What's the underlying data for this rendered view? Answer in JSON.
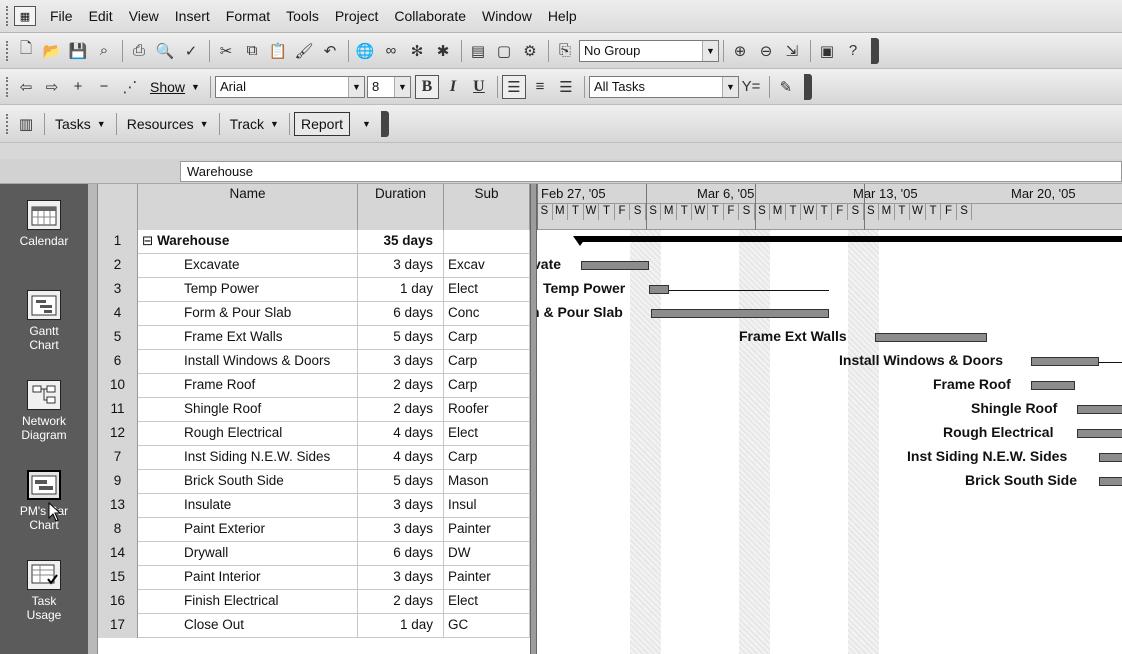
{
  "menu": {
    "items": [
      "File",
      "Edit",
      "View",
      "Insert",
      "Format",
      "Tools",
      "Project",
      "Collaborate",
      "Window",
      "Help"
    ]
  },
  "toolbar_standard": {
    "group_value": "No Group"
  },
  "toolbar_formatting": {
    "show_label": "Show",
    "font_value": "Arial",
    "size_value": "8",
    "bold": "B",
    "italic": "I",
    "underline": "U",
    "filter_value": "All Tasks"
  },
  "project_guide": {
    "tasks": "Tasks",
    "resources": "Resources",
    "track": "Track",
    "report": "Report"
  },
  "entry_bar": {
    "value": "Warehouse"
  },
  "view_bar": {
    "items": [
      {
        "label1": "Calendar",
        "label2": ""
      },
      {
        "label1": "Gantt",
        "label2": "Chart"
      },
      {
        "label1": "Network",
        "label2": "Diagram"
      },
      {
        "label1": "PM's Bar",
        "label2": "Chart"
      },
      {
        "label1": "Task",
        "label2": "Usage"
      }
    ]
  },
  "table": {
    "headers": {
      "name": "Name",
      "duration": "Duration",
      "sub": "Sub"
    },
    "rows": [
      {
        "id": "1",
        "name": "Warehouse",
        "duration": "35 days",
        "sub": "",
        "summary": true
      },
      {
        "id": "2",
        "name": "Excavate",
        "duration": "3 days",
        "sub": "Excav"
      },
      {
        "id": "3",
        "name": "Temp Power",
        "duration": "1 day",
        "sub": "Elect"
      },
      {
        "id": "4",
        "name": "Form & Pour Slab",
        "duration": "6 days",
        "sub": "Conc"
      },
      {
        "id": "5",
        "name": "Frame Ext Walls",
        "duration": "5 days",
        "sub": "Carp"
      },
      {
        "id": "6",
        "name": "Install Windows & Doors",
        "duration": "3 days",
        "sub": "Carp"
      },
      {
        "id": "10",
        "name": "Frame Roof",
        "duration": "2 days",
        "sub": "Carp"
      },
      {
        "id": "11",
        "name": "Shingle Roof",
        "duration": "2 days",
        "sub": "Roofer"
      },
      {
        "id": "12",
        "name": "Rough Electrical",
        "duration": "4 days",
        "sub": "Elect"
      },
      {
        "id": "7",
        "name": "Inst Siding N.E.W. Sides",
        "duration": "4 days",
        "sub": "Carp"
      },
      {
        "id": "9",
        "name": "Brick South Side",
        "duration": "5 days",
        "sub": "Mason"
      },
      {
        "id": "13",
        "name": "Insulate",
        "duration": "3 days",
        "sub": "Insul"
      },
      {
        "id": "8",
        "name": "Paint Exterior",
        "duration": "3 days",
        "sub": "Painter"
      },
      {
        "id": "14",
        "name": "Drywall",
        "duration": "6 days",
        "sub": "DW"
      },
      {
        "id": "15",
        "name": "Paint Interior",
        "duration": "3 days",
        "sub": "Painter"
      },
      {
        "id": "16",
        "name": "Finish Electrical",
        "duration": "2 days",
        "sub": "Elect"
      },
      {
        "id": "17",
        "name": "Close Out",
        "duration": "1 day",
        "sub": "GC"
      }
    ]
  },
  "gantt": {
    "weeks": [
      "Feb 27, '05",
      "Mar 6, '05",
      "Mar 13, '05",
      "Mar 20, '05"
    ],
    "days": [
      "S",
      "M",
      "T",
      "W",
      "T",
      "F",
      "S"
    ],
    "labels": {
      "excavate": "vate",
      "temp_power": "Temp Power",
      "form_pour": "n & Pour Slab",
      "frame_walls": "Frame Ext Walls",
      "windows": "Install Windows & Doors",
      "frame_roof": "Frame Roof",
      "shingle": "Shingle Roof",
      "rough_elec": "Rough Electrical",
      "siding": "Inst Siding N.E.W. Sides",
      "brick": "Brick South Side"
    }
  },
  "colors": {
    "view_bar_bg": "#5b5b5b",
    "bar_fill": "#8c8c8c",
    "header_bg": "#d6d6d6"
  }
}
